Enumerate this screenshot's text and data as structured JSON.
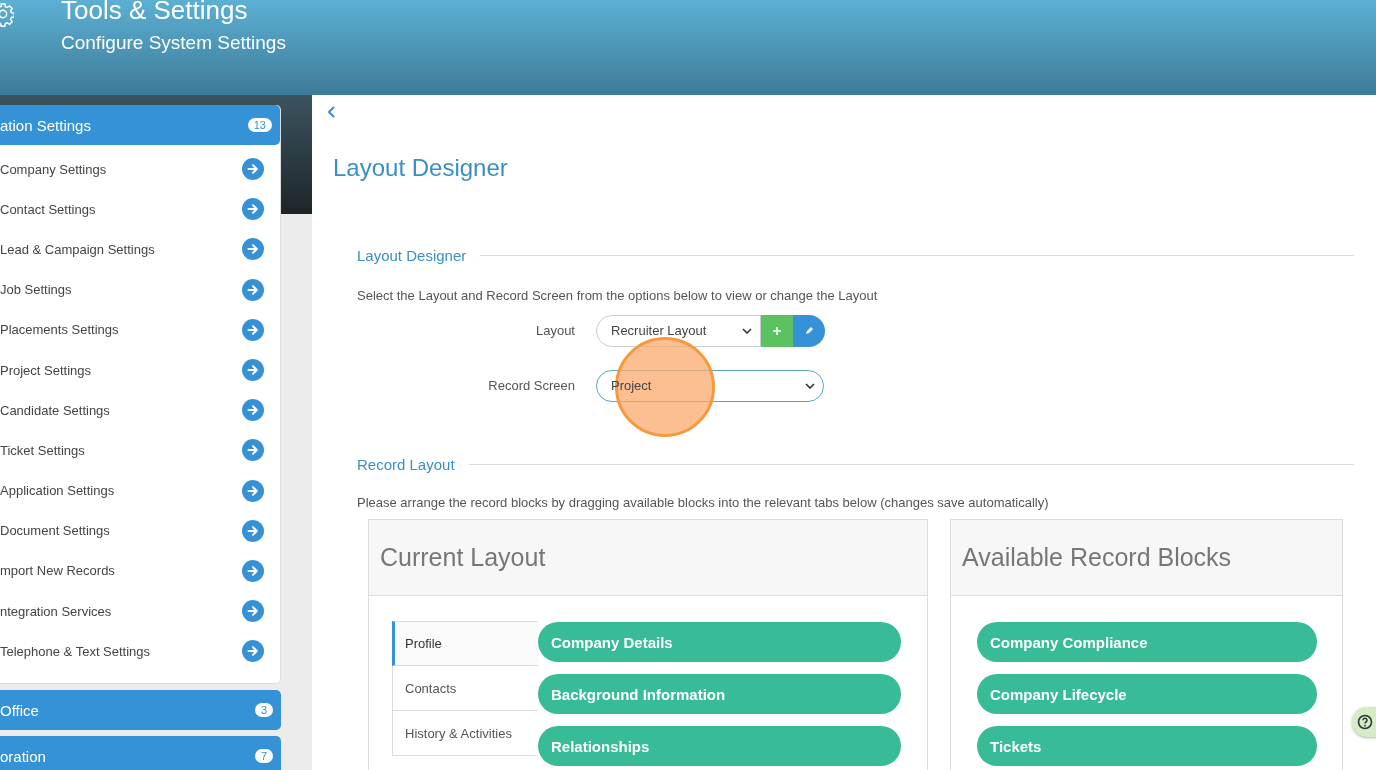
{
  "header": {
    "title": "Tools & Settings",
    "subtitle": "Configure System Settings"
  },
  "sidebar": {
    "groups": [
      {
        "label": "ation Settings",
        "count": "13",
        "expanded": true,
        "items": [
          "Company Settings",
          "Contact Settings",
          "Lead & Campaign Settings",
          "Job Settings",
          "Placements Settings",
          "Project Settings",
          "Candidate Settings",
          "Ticket Settings",
          "Application Settings",
          "Document Settings",
          "mport New Records",
          "ntegration Services",
          "Telephone & Text Settings"
        ]
      },
      {
        "label": "Office",
        "count": "3",
        "expanded": false
      },
      {
        "label": "oration",
        "count": "7",
        "expanded": false
      }
    ]
  },
  "page": {
    "title": "Layout Designer"
  },
  "layout_designer": {
    "heading": "Layout Designer",
    "description": "Select the Layout and Record Screen from the options below to view or change the Layout",
    "fields": [
      {
        "label": "Layout",
        "kind": "select-with-actions",
        "value": "Recruiter Layout"
      },
      {
        "label": "Record Screen",
        "kind": "select",
        "value": "Project"
      }
    ]
  },
  "record_layout": {
    "heading": "Record Layout",
    "description": "Please arrange the record blocks by dragging available blocks into the relevant tabs below (changes save automatically)",
    "current_layout": {
      "title": "Current Layout",
      "tabs": [
        {
          "label": "Profile",
          "selected": true
        },
        {
          "label": "Contacts",
          "selected": false
        },
        {
          "label": "History & Activities",
          "selected": false
        }
      ],
      "blocks": [
        "Company Details",
        "Background Information",
        "Relationships"
      ]
    },
    "available_blocks": {
      "title": "Available Record Blocks",
      "blocks": [
        "Company Compliance",
        "Company Lifecycle",
        "Tickets"
      ]
    }
  }
}
